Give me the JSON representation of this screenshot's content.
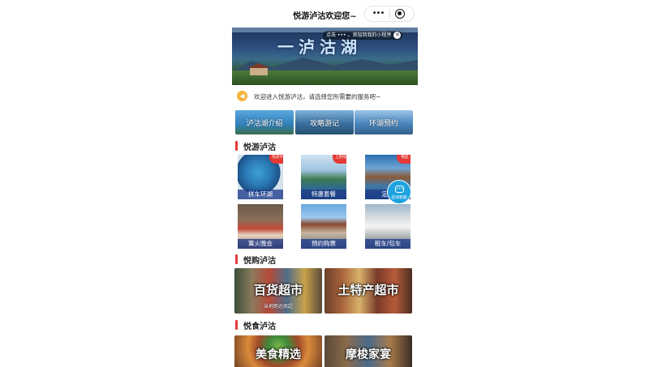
{
  "app": {
    "title": "悦游泸沽欢迎您~",
    "menu_glyph": "•••"
  },
  "banner": {
    "heading": "一泸沽湖",
    "add_hint": "点击 ••• ，添加到我的小程序",
    "close_glyph": "✕"
  },
  "notice": {
    "icon": "speaker-icon",
    "text": "欢迎进入悦游泸沽，请选择您所需要的服务吧~"
  },
  "quick_links": [
    {
      "label": "泸沽湖介绍"
    },
    {
      "label": "攻略游记"
    },
    {
      "label": "环湖预约"
    }
  ],
  "sections": {
    "tour": "悦游泸沽",
    "shop": "悦购泸沽",
    "food": "悦食泸沽"
  },
  "tour_tiles": [
    {
      "label": "拼车环湖",
      "badge": "热卖中"
    },
    {
      "label": "特惠套餐",
      "badge": "上新啦"
    },
    {
      "label": "定制",
      "badge": "精品"
    },
    {
      "label": "篝火晚会",
      "badge": ""
    },
    {
      "label": "预约购票",
      "badge": ""
    },
    {
      "label": "租车/包车",
      "badge": ""
    }
  ],
  "service": {
    "label": "在线客服",
    "icon": "chat-icon"
  },
  "shop_banners": [
    {
      "title": "百货超市",
      "subtitle": "当地朗达商超"
    },
    {
      "title": "土特产超市",
      "subtitle": ""
    }
  ],
  "food_banners": [
    {
      "title": "美食精选"
    },
    {
      "title": "摩梭家宴"
    }
  ],
  "colors": {
    "accent": "#e63a3a",
    "label_bg": "#1e3c8c",
    "service": "#1fa3e0"
  }
}
